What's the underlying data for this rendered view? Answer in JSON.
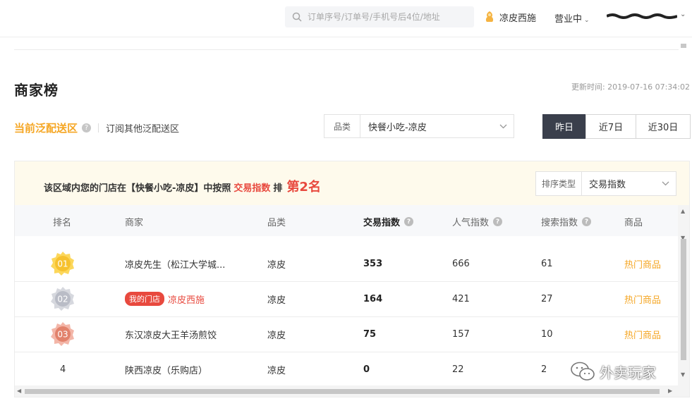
{
  "header": {
    "search_placeholder": "订单序号/订单号/手机号后4位/地址",
    "shop_name": "凉皮西施",
    "status": "营业中",
    "chevron": "⌄"
  },
  "page": {
    "title": "商家榜",
    "updated_label": "更新时间:",
    "updated_time": "2019-07-16 07:34:02"
  },
  "zone": {
    "current": "当前泛配送区",
    "help": "?",
    "subscribe": "订阅其他泛配送区"
  },
  "category": {
    "label": "品类",
    "value": "快餐小吃-凉皮"
  },
  "periods": [
    {
      "label": "昨日",
      "active": true
    },
    {
      "label": "近7日",
      "active": false
    },
    {
      "label": "近30日",
      "active": false
    }
  ],
  "banner": {
    "prefix": "该区域内您的门店在【快餐小吃-凉皮】中按照",
    "metric": "交易指数",
    "middle": "排",
    "rank": "第2名"
  },
  "sort": {
    "label": "排序类型",
    "value": "交易指数"
  },
  "table": {
    "headers": {
      "rank": "排名",
      "merchant": "商家",
      "category": "品类",
      "trade": "交易指数",
      "popularity": "人气指数",
      "search": "搜索指数",
      "goods": "商品"
    },
    "rows": [
      {
        "rank": "01",
        "merchant": "凉皮先生（松江大学城...",
        "category": "凉皮",
        "trade": "353",
        "popularity": "666",
        "search": "61",
        "goods": "热门商品"
      },
      {
        "rank": "02",
        "tag": "我的门店",
        "merchant": "凉皮西施",
        "category": "凉皮",
        "trade": "164",
        "popularity": "421",
        "search": "27",
        "goods": "热门商品"
      },
      {
        "rank": "03",
        "merchant": "东汉凉皮大王羊汤煎饺",
        "category": "凉皮",
        "trade": "75",
        "popularity": "157",
        "search": "10",
        "goods": "热门商品"
      },
      {
        "rank": "4",
        "merchant": "陕西凉皮（乐购店）",
        "category": "凉皮",
        "trade": "0",
        "popularity": "22",
        "search": "2",
        "goods": ""
      }
    ]
  },
  "watermark": "外卖玩家",
  "colors": {
    "accent_orange": "#f5a623",
    "accent_red": "#e8493e",
    "active_period": "#3a3f4c",
    "banner_bg": "#fefaec"
  }
}
